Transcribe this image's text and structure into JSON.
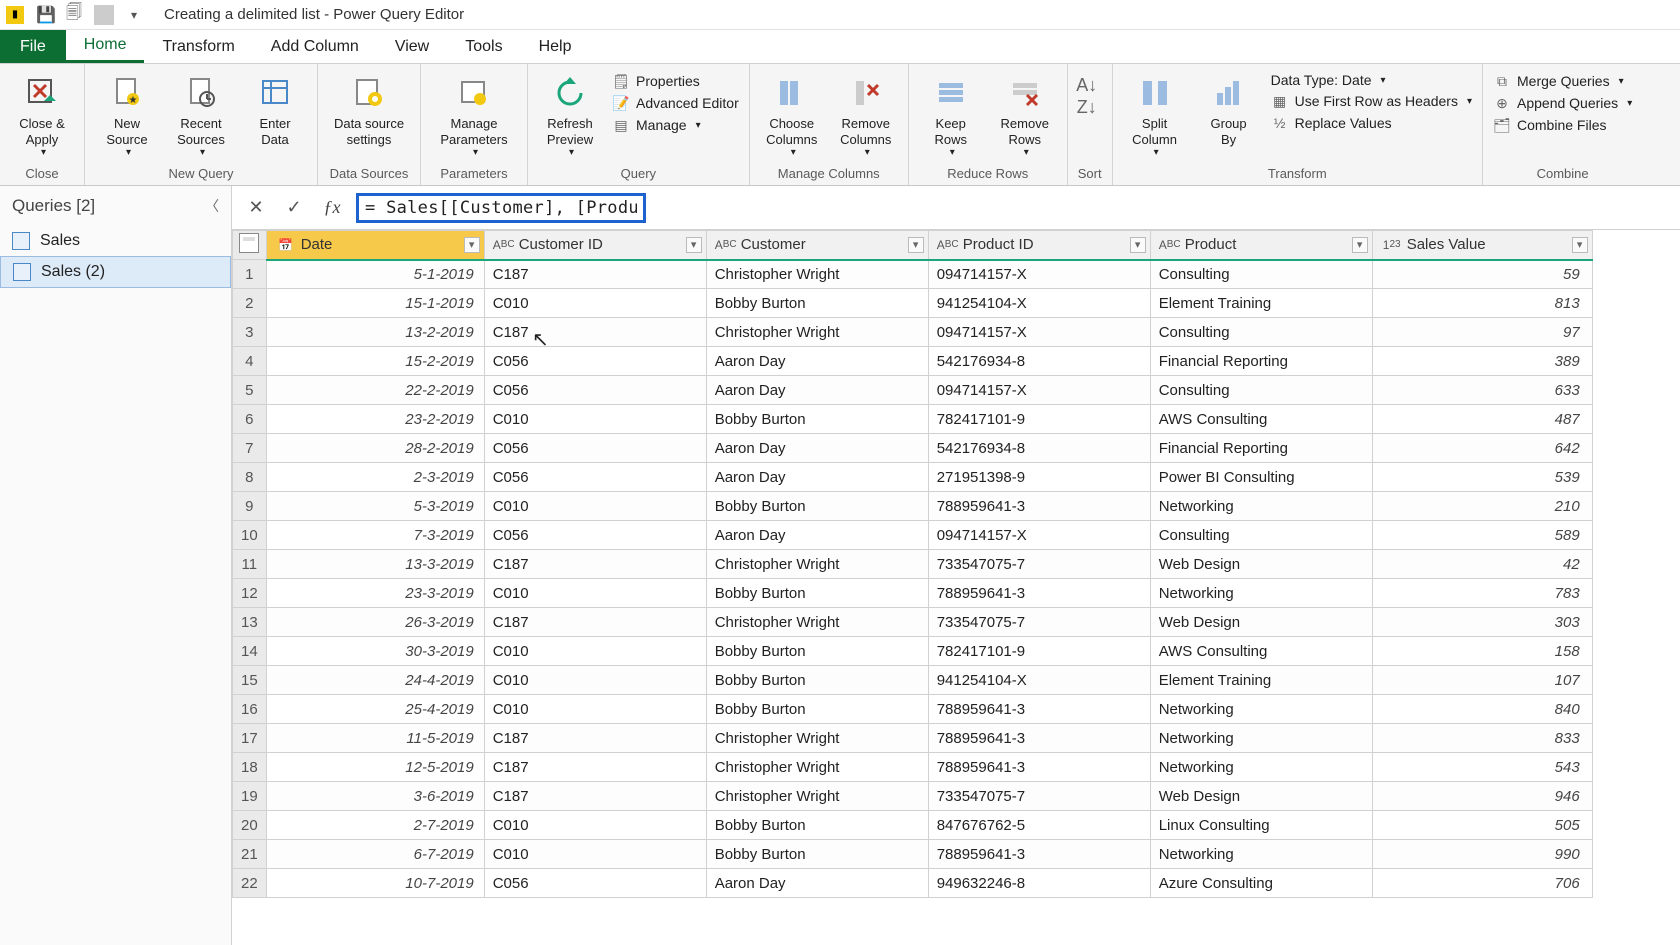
{
  "titleBar": {
    "title": "Creating a delimited list - Power Query Editor"
  },
  "menu": {
    "file": "File",
    "tabs": [
      "Home",
      "Transform",
      "Add Column",
      "View",
      "Tools",
      "Help"
    ],
    "activeTab": "Home"
  },
  "ribbon": {
    "close": {
      "closeApply": "Close &\nApply",
      "group": "Close"
    },
    "newQuery": {
      "newSource": "New\nSource",
      "recentSources": "Recent\nSources",
      "enterData": "Enter\nData",
      "group": "New Query"
    },
    "dataSources": {
      "settings": "Data source\nsettings",
      "group": "Data Sources"
    },
    "parameters": {
      "manage": "Manage\nParameters",
      "group": "Parameters"
    },
    "query": {
      "refresh": "Refresh\nPreview",
      "properties": "Properties",
      "advanced": "Advanced Editor",
      "manage": "Manage",
      "group": "Query"
    },
    "manageColumns": {
      "choose": "Choose\nColumns",
      "remove": "Remove\nColumns",
      "group": "Manage Columns"
    },
    "reduceRows": {
      "keep": "Keep\nRows",
      "remove": "Remove\nRows",
      "group": "Reduce Rows"
    },
    "sort": {
      "group": "Sort"
    },
    "transform": {
      "split": "Split\nColumn",
      "groupBy": "Group\nBy",
      "dataType": "Data Type: Date",
      "firstRow": "Use First Row as Headers",
      "replace": "Replace Values",
      "group": "Transform"
    },
    "combine": {
      "merge": "Merge Queries",
      "append": "Append Queries",
      "combineFiles": "Combine Files",
      "group": "Combine"
    }
  },
  "queriesPane": {
    "header": "Queries [2]",
    "items": [
      {
        "name": "Sales"
      },
      {
        "name": "Sales (2)"
      }
    ],
    "selectedIndex": 1
  },
  "formula": {
    "value": "= Sales[[Customer], [Product]]"
  },
  "columns": [
    {
      "name": "Date",
      "type": "date",
      "selected": true
    },
    {
      "name": "Customer ID",
      "type": "text"
    },
    {
      "name": "Customer",
      "type": "text"
    },
    {
      "name": "Product ID",
      "type": "text"
    },
    {
      "name": "Product",
      "type": "text"
    },
    {
      "name": "Sales Value",
      "type": "number"
    }
  ],
  "rows": [
    {
      "n": 1,
      "date": "5-1-2019",
      "cid": "C187",
      "cust": "Christopher Wright",
      "pid": "094714157-X",
      "prod": "Consulting",
      "val": "59"
    },
    {
      "n": 2,
      "date": "15-1-2019",
      "cid": "C010",
      "cust": "Bobby Burton",
      "pid": "941254104-X",
      "prod": "Element Training",
      "val": "813"
    },
    {
      "n": 3,
      "date": "13-2-2019",
      "cid": "C187",
      "cust": "Christopher Wright",
      "pid": "094714157-X",
      "prod": "Consulting",
      "val": "97"
    },
    {
      "n": 4,
      "date": "15-2-2019",
      "cid": "C056",
      "cust": "Aaron Day",
      "pid": "542176934-8",
      "prod": "Financial Reporting",
      "val": "389"
    },
    {
      "n": 5,
      "date": "22-2-2019",
      "cid": "C056",
      "cust": "Aaron Day",
      "pid": "094714157-X",
      "prod": "Consulting",
      "val": "633"
    },
    {
      "n": 6,
      "date": "23-2-2019",
      "cid": "C010",
      "cust": "Bobby Burton",
      "pid": "782417101-9",
      "prod": "AWS Consulting",
      "val": "487"
    },
    {
      "n": 7,
      "date": "28-2-2019",
      "cid": "C056",
      "cust": "Aaron Day",
      "pid": "542176934-8",
      "prod": "Financial Reporting",
      "val": "642"
    },
    {
      "n": 8,
      "date": "2-3-2019",
      "cid": "C056",
      "cust": "Aaron Day",
      "pid": "271951398-9",
      "prod": "Power BI Consulting",
      "val": "539"
    },
    {
      "n": 9,
      "date": "5-3-2019",
      "cid": "C010",
      "cust": "Bobby Burton",
      "pid": "788959641-3",
      "prod": "Networking",
      "val": "210"
    },
    {
      "n": 10,
      "date": "7-3-2019",
      "cid": "C056",
      "cust": "Aaron Day",
      "pid": "094714157-X",
      "prod": "Consulting",
      "val": "589"
    },
    {
      "n": 11,
      "date": "13-3-2019",
      "cid": "C187",
      "cust": "Christopher Wright",
      "pid": "733547075-7",
      "prod": "Web Design",
      "val": "42"
    },
    {
      "n": 12,
      "date": "23-3-2019",
      "cid": "C010",
      "cust": "Bobby Burton",
      "pid": "788959641-3",
      "prod": "Networking",
      "val": "783"
    },
    {
      "n": 13,
      "date": "26-3-2019",
      "cid": "C187",
      "cust": "Christopher Wright",
      "pid": "733547075-7",
      "prod": "Web Design",
      "val": "303"
    },
    {
      "n": 14,
      "date": "30-3-2019",
      "cid": "C010",
      "cust": "Bobby Burton",
      "pid": "782417101-9",
      "prod": "AWS Consulting",
      "val": "158"
    },
    {
      "n": 15,
      "date": "24-4-2019",
      "cid": "C010",
      "cust": "Bobby Burton",
      "pid": "941254104-X",
      "prod": "Element Training",
      "val": "107"
    },
    {
      "n": 16,
      "date": "25-4-2019",
      "cid": "C010",
      "cust": "Bobby Burton",
      "pid": "788959641-3",
      "prod": "Networking",
      "val": "840"
    },
    {
      "n": 17,
      "date": "11-5-2019",
      "cid": "C187",
      "cust": "Christopher Wright",
      "pid": "788959641-3",
      "prod": "Networking",
      "val": "833"
    },
    {
      "n": 18,
      "date": "12-5-2019",
      "cid": "C187",
      "cust": "Christopher Wright",
      "pid": "788959641-3",
      "prod": "Networking",
      "val": "543"
    },
    {
      "n": 19,
      "date": "3-6-2019",
      "cid": "C187",
      "cust": "Christopher Wright",
      "pid": "733547075-7",
      "prod": "Web Design",
      "val": "946"
    },
    {
      "n": 20,
      "date": "2-7-2019",
      "cid": "C010",
      "cust": "Bobby Burton",
      "pid": "847676762-5",
      "prod": "Linux Consulting",
      "val": "505"
    },
    {
      "n": 21,
      "date": "6-7-2019",
      "cid": "C010",
      "cust": "Bobby Burton",
      "pid": "788959641-3",
      "prod": "Networking",
      "val": "990"
    },
    {
      "n": 22,
      "date": "10-7-2019",
      "cid": "C056",
      "cust": "Aaron Day",
      "pid": "949632246-8",
      "prod": "Azure Consulting",
      "val": "706"
    }
  ]
}
